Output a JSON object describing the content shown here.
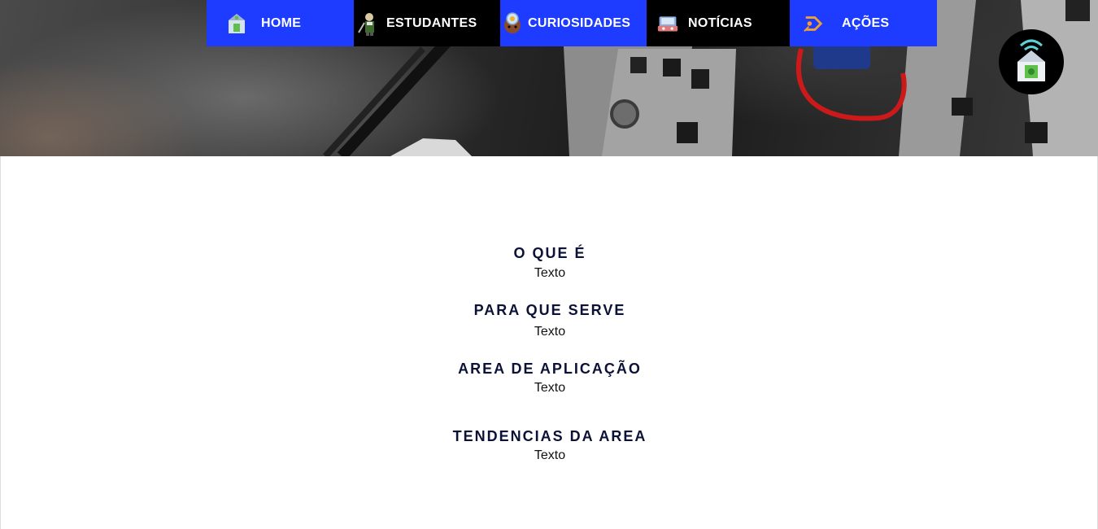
{
  "nav": {
    "items": [
      {
        "label": "HOME",
        "icon": "home-icon"
      },
      {
        "label": "ESTUDANTES",
        "icon": "student-icon"
      },
      {
        "label": "CURIOSIDADES",
        "icon": "curiosity-icon"
      },
      {
        "label": "NOTÍCIAS",
        "icon": "news-icon"
      },
      {
        "label": "AÇÕES",
        "icon": "actions-icon"
      }
    ],
    "colors": {
      "blue": "#1e3cff",
      "black": "#000000"
    }
  },
  "fab": {
    "icon": "smart-home-icon"
  },
  "sections": [
    {
      "title": "O QUE É",
      "text": "Texto"
    },
    {
      "title": "PARA QUE SERVE",
      "text": "Texto"
    },
    {
      "title": "AREA DE APLICAÇÃO",
      "text": "Texto"
    },
    {
      "title": "TENDENCIAS DA AREA",
      "text": "Texto"
    }
  ],
  "colors": {
    "heading": "#0c1236",
    "text": "#111111",
    "background": "#ffffff"
  }
}
